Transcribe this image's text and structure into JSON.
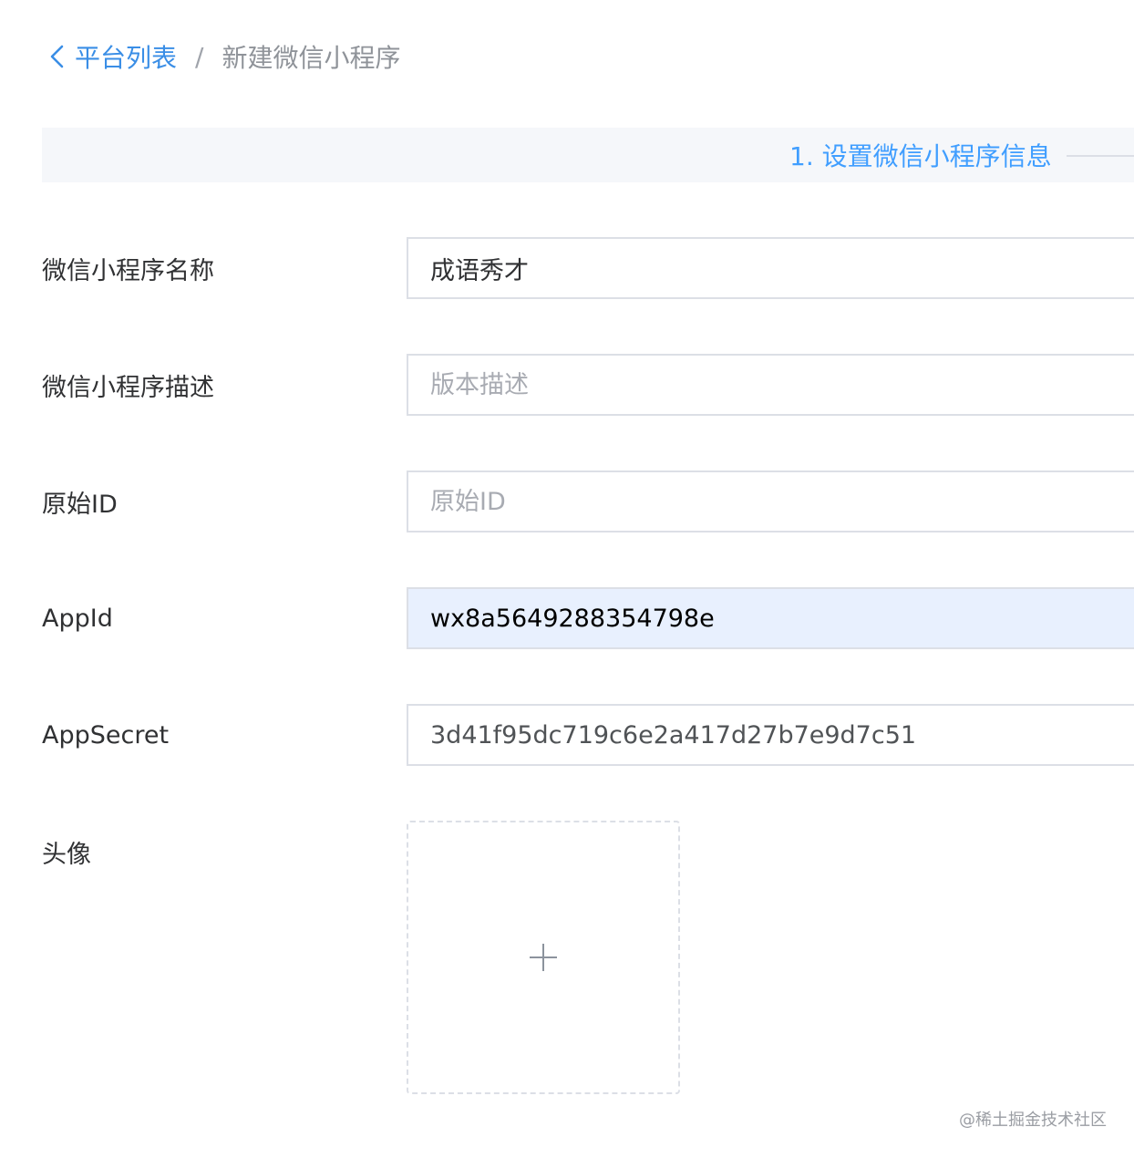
{
  "breadcrumb": {
    "back_label": "平台列表",
    "separator": "/",
    "current": "新建微信小程序"
  },
  "steps": {
    "active_label": "1. 设置微信小程序信息"
  },
  "form": {
    "name": {
      "label": "微信小程序名称",
      "value": "成语秀才",
      "placeholder": ""
    },
    "description": {
      "label": "微信小程序描述",
      "value": "",
      "placeholder": "版本描述"
    },
    "original_id": {
      "label": "原始ID",
      "value": "",
      "placeholder": "原始ID"
    },
    "app_id": {
      "label": "AppId",
      "value": "wx8a5649288354798e",
      "placeholder": ""
    },
    "app_secret": {
      "label": "AppSecret",
      "value": "3d41f95dc719c6e2a417d27b7e9d7c51",
      "placeholder": ""
    },
    "avatar": {
      "label": "头像"
    }
  },
  "watermark": "@稀土掘金技术社区",
  "colors": {
    "accent": "#409eff",
    "autofill_bg": "#e8f0fe",
    "border": "#dcdfe6",
    "step_bg": "#f5f7fa"
  },
  "icons": {
    "back": "chevron-left-icon",
    "upload": "plus-icon"
  }
}
